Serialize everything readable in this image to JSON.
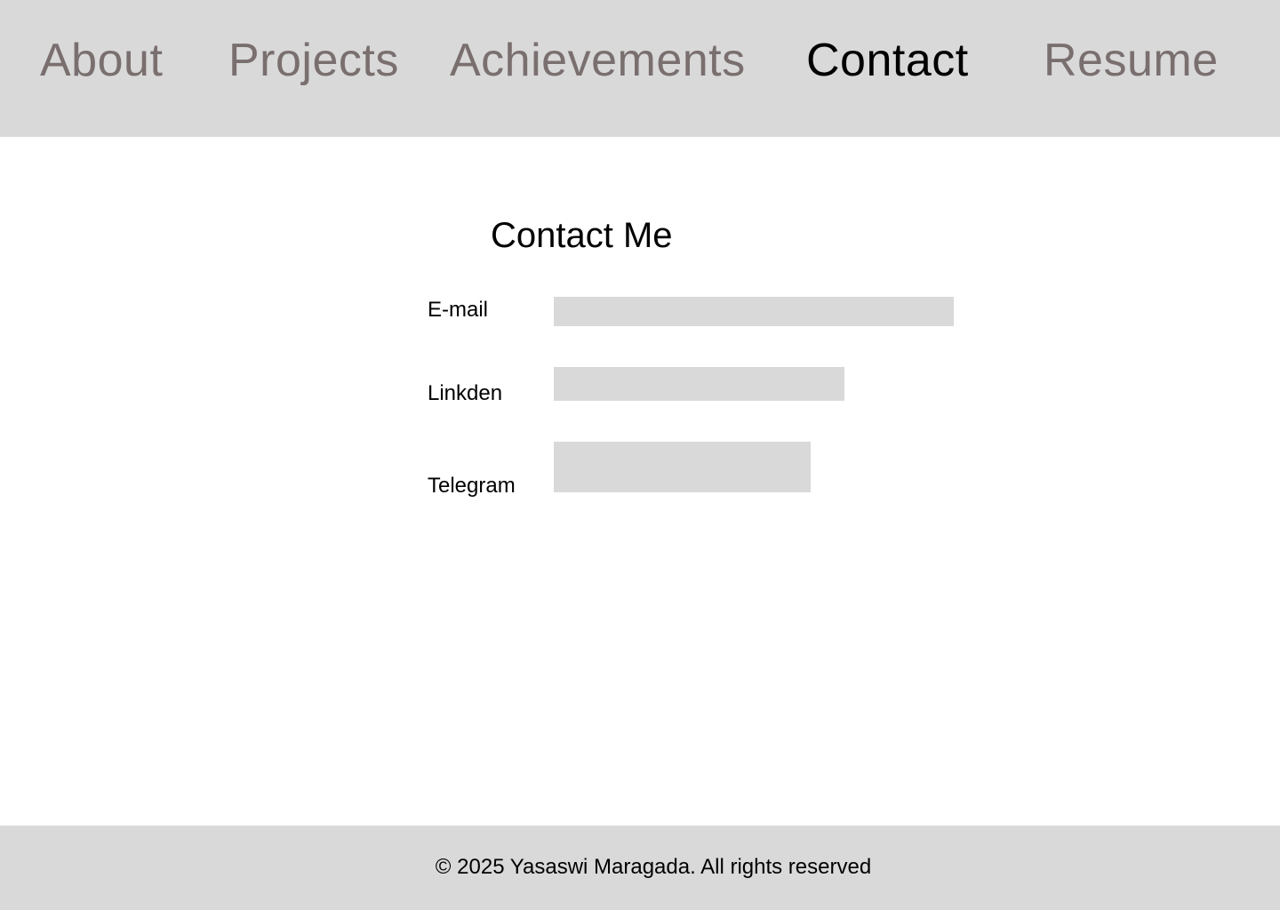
{
  "nav": {
    "items": [
      {
        "label": "About"
      },
      {
        "label": "Projects"
      },
      {
        "label": "Achievements"
      },
      {
        "label": "Contact"
      },
      {
        "label": "Resume"
      }
    ],
    "active": "Contact"
  },
  "contact": {
    "title": "Contact Me",
    "fields": [
      {
        "label": "E-mail",
        "value": "",
        "placeholder": ""
      },
      {
        "label": "Linkden",
        "value": "",
        "placeholder": ""
      },
      {
        "label": "Telegram",
        "value": "",
        "placeholder": ""
      }
    ]
  },
  "footer": {
    "text": "© 2025 Yasaswi Maragada. All rights reserved"
  },
  "colors": {
    "bar_background": "#d9d9d9",
    "nav_inactive": "#7a6f6f",
    "nav_active": "#000000",
    "page_background": "#ffffff"
  }
}
